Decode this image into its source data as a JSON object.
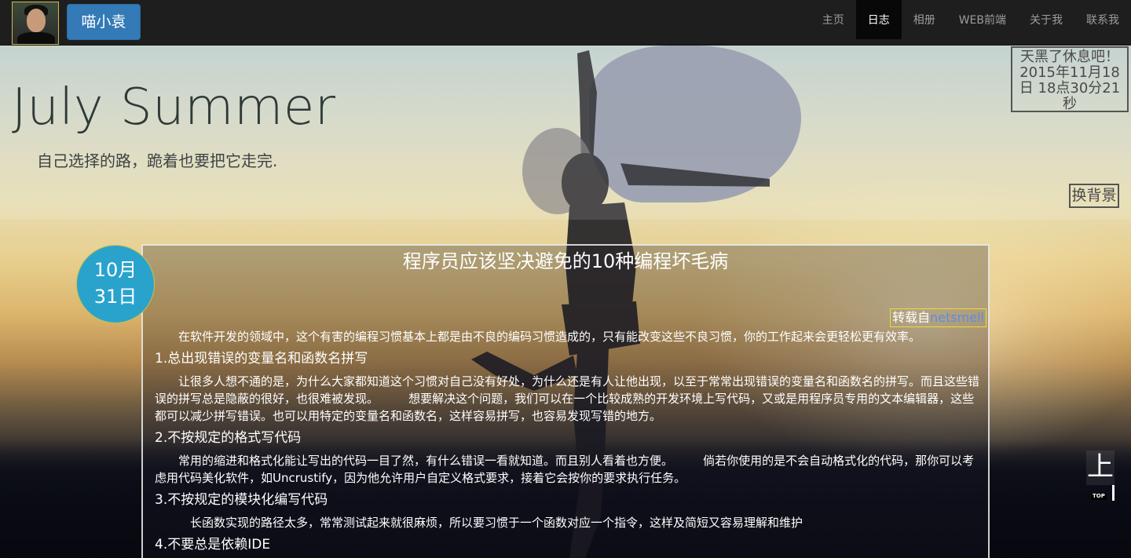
{
  "nav": {
    "brand": "喵小袁",
    "items": [
      {
        "label": "主页",
        "active": false
      },
      {
        "label": "日志",
        "active": true
      },
      {
        "label": "相册",
        "active": false
      },
      {
        "label": "WEB前端",
        "active": false
      },
      {
        "label": "关于我",
        "active": false
      },
      {
        "label": "联系我",
        "active": false
      }
    ]
  },
  "banner": {
    "title": "July Summer",
    "motto": "自己选择的路，跪着也要把它走完."
  },
  "clock": {
    "line1": "天黑了休息吧！",
    "line2": "2015年11月18",
    "line3": "日 18点30分21",
    "line4": "秒"
  },
  "bg_switch": "换背景",
  "article": {
    "month": "10月",
    "day": "31日",
    "title": "程序员应该坚决避免的10种编程坏毛病",
    "source_prefix": "转载自",
    "source_link": "netsmell",
    "intro": "在软件开发的领域中，这个有害的编程习惯基本上都是由不良的编码习惯造成的，只有能改变这些不良习惯，你的工作起来会更轻松更有效率。",
    "s1_heading": "1.总出现错误的变量名和函数名拼写",
    "s1_body": "让很多人想不通的是，为什么大家都知道这个习惯对自己没有好处，为什么还是有人让他出现，以至于常常出现错误的变量名和函数名的拼写。而且这些错误的拼写总是隐蔽的很好，也很难被发现。        想要解决这个问题，我们可以在一个比较成熟的开发环境上写代码，又或是用程序员专用的文本编辑器，这些都可以减少拼写错误。也可以用特定的变量名和函数名，这样容易拼写，也容易发现写错的地方。",
    "s2_heading": "2.不按规定的格式写代码",
    "s2_body": "常用的缩进和格式化能让写出的代码一目了然，有什么错误一看就知道。而且别人看着也方便。        倘若你使用的是不会自动格式化的代码，那你可以考虑用代码美化软件，如Uncrustify，因为他允许用户自定义格式要求，接着它会按你的要求执行任务。",
    "s3_heading": "3.不按规定的模块化编写代码",
    "s3_body": "长函数实现的路径太多，常常测试起来就很麻烦，所以要习惯于一个函数对应一个指令，这样及简短又容易理解和维护",
    "s4_heading": "4.不要总是依赖IDE"
  },
  "to_top": {
    "glyph": "上",
    "label": "TOP"
  }
}
